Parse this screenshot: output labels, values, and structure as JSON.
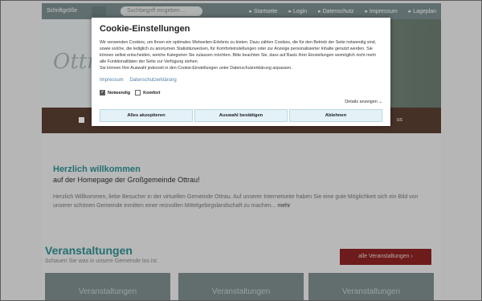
{
  "topbar": {
    "fontsize_label": "Schriftgröße",
    "search_placeholder": "Suchbegriff eingeben ...",
    "links": [
      "Startseite",
      "Login",
      "Datenschutz",
      "Impressum",
      "Lageplan"
    ]
  },
  "welcome": {
    "title": "Herzlich willkommen",
    "subtitle": "auf der Homepage der Großgemeinde Ottrau!",
    "text": "Herzlich Willkommen, liebe Besucher in der virtuellen Gemeinde Ottrau. Auf unserer Internetseite haben Sie eine gute Möglichkeit sich ein Bild von unserer schönen Gemeinde inmitten einer reizvollen Mittelgebirgslandschaft zu machen...",
    "more_link": "mehr"
  },
  "events": {
    "title": "Veranstaltungen",
    "subtitle": "Schauen Sie was in unsere Gemeinde los ist.",
    "all_button": "alle Veranstaltungen",
    "card_titles": [
      "Veranstaltungen",
      "Veranstaltungen",
      "Veranstaltungen"
    ]
  },
  "cookie": {
    "title": "Cookie-Einstellungen",
    "text": "Wir verwenden Cookies, um Ihnen ein optimales Webseiten-Erlebnis zu bieten. Dazu zählen Cookies, die für den Betrieb der Seite notwendig sind, sowie solche, die lediglich zu anonymen Statistikzwecken, für Komforteinstellungen oder zur Anzeige personalisierter Inhalte genutzt werden. Sie können selbst entscheiden, welche Kategorien Sie zulassen möchten. Bitte beachten Sie, dass auf Basis Ihrer Einstellungen womöglich nicht mehr alle Funktionalitäten der Seite zur Verfügung stehen.",
    "text2": "Sie können Ihre Auswahl jederzeit in den Cookie-Einstellungen unter Datenschutzerklärung anpassen.",
    "link_impressum": "Impressum",
    "link_privacy": "Datenschutzerklärung",
    "check_necessary": "Notwendig",
    "check_comfort": "Komfort",
    "details": "Details anzeigen",
    "btn_accept_all": "Alles akzeptieren",
    "btn_confirm": "Auswahl bestätigen",
    "btn_decline": "Ablehnen"
  }
}
